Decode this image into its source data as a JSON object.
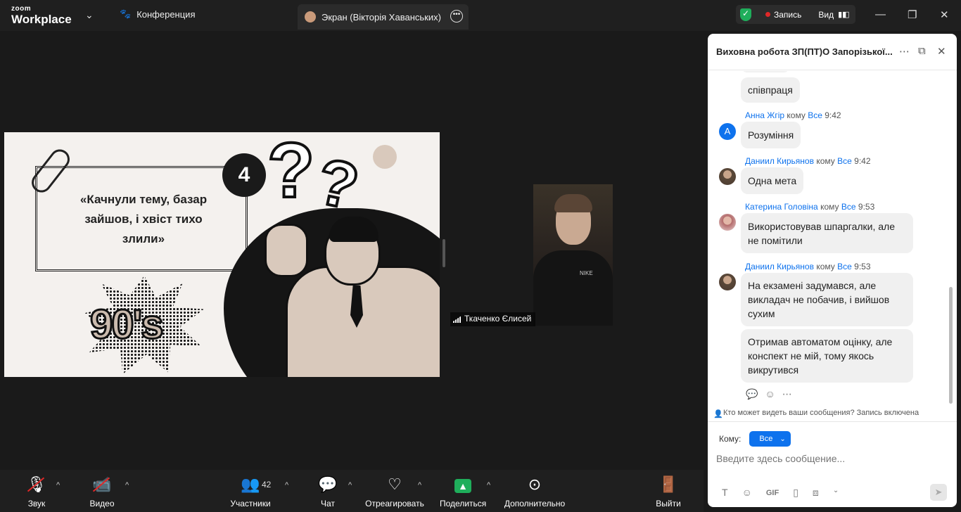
{
  "app": {
    "logo_small": "zoom",
    "logo_big": "Workplace"
  },
  "topbar": {
    "conference_label": "Конференция",
    "screen_tab_label": "Экран (Вікторія Хаванських)",
    "record_label": "Запись",
    "view_label": "Вид"
  },
  "slide": {
    "number": "4",
    "text": "«Качнули тему, базар зайшов, і хвіст тихо злили»",
    "badge_90s": "90's"
  },
  "video": {
    "participant_name": "Ткаченко Єлисей",
    "shirt_logo": "NIKE"
  },
  "chat": {
    "title": "Виховна робота ЗП(ПТ)О Запорізької...",
    "messages": [
      {
        "text": "співпраця"
      },
      {
        "sender": "Анна Жгір",
        "to_word": "кому",
        "to": "Все",
        "time": "9:42",
        "avatar_letter": "А",
        "text": "Розуміння"
      },
      {
        "sender": "Даниил Кирьянов",
        "to_word": "кому",
        "to": "Все",
        "time": "9:42",
        "text": "Одна мета"
      },
      {
        "sender": "Катерина Головіна",
        "to_word": "кому",
        "to": "Все",
        "time": "9:53",
        "text": "Використовував шпаргалки, але не помітили"
      },
      {
        "sender": "Даниил Кирьянов",
        "to_word": "кому",
        "to": "Все",
        "time": "9:53",
        "text": "На екзамені задумався, але викладач не побачив, і вийшов сухим"
      },
      {
        "text": "Отримав автоматом оцінку, але конспект не мій, тому якось викрутився"
      }
    ],
    "privacy_text": "Кто может видеть ваши сообщения? Запись включена",
    "to_label": "Кому:",
    "to_value": "Все",
    "input_placeholder": "Введите здесь сообщение..."
  },
  "toolbar": {
    "audio": "Звук",
    "video": "Видео",
    "participants": "Участники",
    "participants_count": "42",
    "chat": "Чат",
    "react": "Отреагировать",
    "share": "Поделиться",
    "more": "Дополнительно",
    "leave": "Выйти"
  },
  "colors": {
    "accent": "#0e72ed",
    "share_green": "#1fae5b",
    "record_red": "#e02828"
  }
}
